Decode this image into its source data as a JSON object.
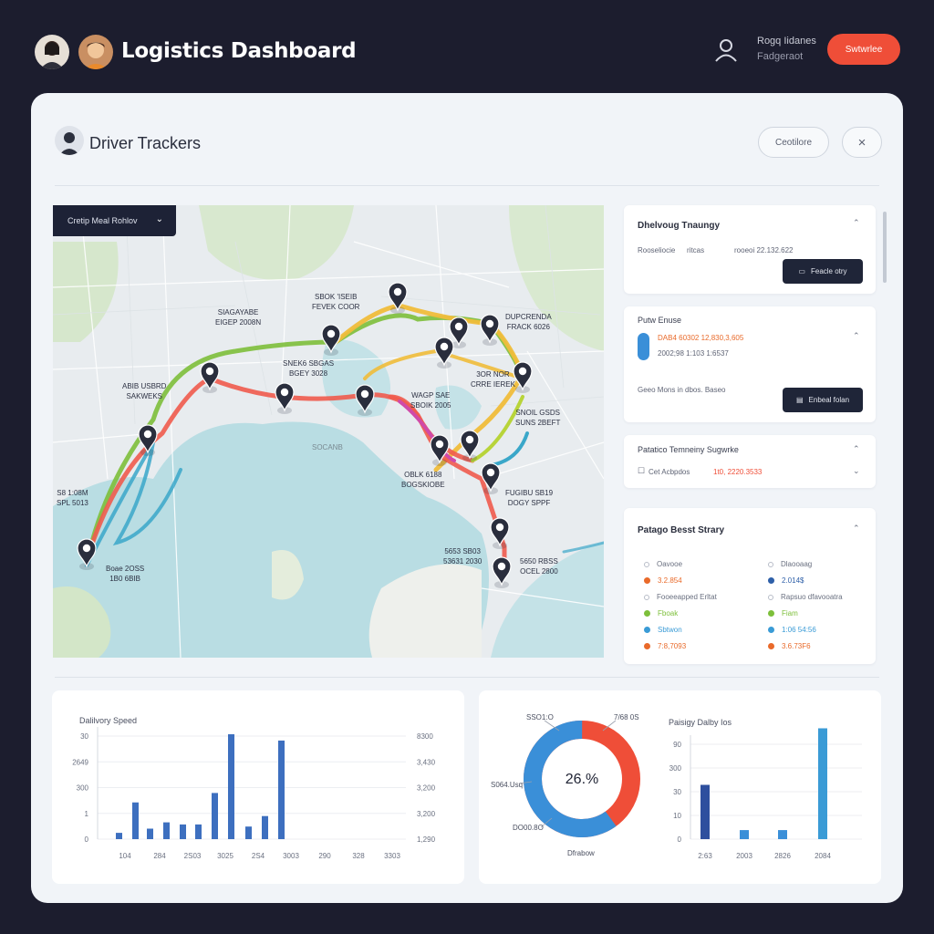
{
  "header": {
    "app_title": "Logistics Dashboard",
    "user_line1": "Rogq Iidanes",
    "user_line2": "Fadgeraot",
    "action_button": "Swtwrlee"
  },
  "panel": {
    "title": "Driver Trackers",
    "pill_button": "Ceotilore",
    "close_glyph": "×"
  },
  "map": {
    "dropdown_label": "Cretip Meal Rohlov",
    "labels": [
      "SIAGAYABE\nEIGEP 2008N",
      "SBOK 'ISEIB\nFEVEK COOR",
      "DUPCRENDA\nFRACK 6026",
      "ABIB USBRD\nSAKWEKS",
      "SNEK6 SBGAS\nBGEY 3028",
      "WAGP SAE\nSBOIK 2005",
      "3OR NOR\nCRRE IEREK",
      "SNOIL GSDS\nSUNS 2BEFT",
      "S8 1:08M\nSPL 5013",
      "OBLK 6188\nBOGSKIOBE",
      "FUGIBU SB19\nDOGY SPPF",
      "Boae 2OSS\n1B0 6BIB",
      "5653 SB03\n53631 2030",
      "5650 RBSS\nOCEL 2800",
      "SOCANB"
    ]
  },
  "cards": {
    "card1": {
      "title": "Dhelvoug Tnaungy",
      "sub_a": "Rooseliocie",
      "sub_b": "ritcas",
      "sub_c": "rooeoi 22.132.622",
      "button": "Feacle otry"
    },
    "card2": {
      "title": "Putw Enuse",
      "value1": "DAB4 60302 12,830,3,605",
      "value2": "2002;98 1:103 1:6537",
      "note": "Geeo Mons in dbos. Baseo",
      "button": "Enbeal folan"
    },
    "card3": {
      "title": "Patatico Temneiny Sugwrke",
      "meta": "Cet Acbpdos",
      "value": "1t0, 2220.3533"
    },
    "card4": {
      "title": "Patago Besst Strary",
      "left_items": [
        {
          "label": "Oavooe",
          "color": "#9aa0ad"
        },
        {
          "label": "3.2.854",
          "color": "#e96a2a"
        },
        {
          "label": "Fooeeapped Erltat",
          "color": "#9aa0ad"
        },
        {
          "label": "Fboak",
          "color": "#7dbf3a"
        },
        {
          "label": "Sbtwon",
          "color": "#3a9bd6"
        },
        {
          "label": "7:8,7093",
          "color": "#e96a2a"
        }
      ],
      "right_items": [
        {
          "label": "Dlaooaag",
          "color": "#9aa0ad"
        },
        {
          "label": "2.014$",
          "color": "#2e5fa8"
        },
        {
          "label": "Rapsuo dfavooatra",
          "color": "#9aa0ad"
        },
        {
          "label": "Fiam",
          "color": "#7dbf3a"
        },
        {
          "label": "1:06 54:56",
          "color": "#3a9bd6"
        },
        {
          "label": "3.6.73F6",
          "color": "#e96a2a"
        }
      ]
    }
  },
  "charts": {
    "speed": {
      "title": "Dalilvory Speed",
      "y_left": [
        "30",
        "2649",
        "300",
        "1",
        "0"
      ],
      "y_right": [
        "8300",
        "3,430",
        "3,200",
        "3,200",
        "1,290"
      ],
      "x": [
        "104",
        "284",
        "2S03",
        "3025",
        "2S4",
        "3003",
        "290",
        "328",
        "3303"
      ],
      "bars": [
        0.06,
        0.35,
        0.1,
        0.16,
        0.14,
        0.14,
        0.44,
        1.0,
        0.12,
        0.22,
        0.94
      ]
    },
    "donut": {
      "center": "26.%",
      "labels_tl": "SSO1:O",
      "labels_tr": "7/68 0S",
      "labels_l": "S064.Usq",
      "labels_bl": "DO00.8O",
      "caption": "Dfrabow",
      "blue_fraction": 0.6,
      "blue": "#3a8fd8",
      "red": "#ef4e38"
    },
    "delay": {
      "title": "Paisigy Dalby Ios",
      "y": [
        "90",
        "300",
        "30",
        "10",
        "0"
      ],
      "x": [
        "2:63",
        "2003",
        "2826",
        "2084"
      ],
      "bars": [
        0.48,
        0.08,
        0.08,
        0.98
      ]
    }
  }
}
